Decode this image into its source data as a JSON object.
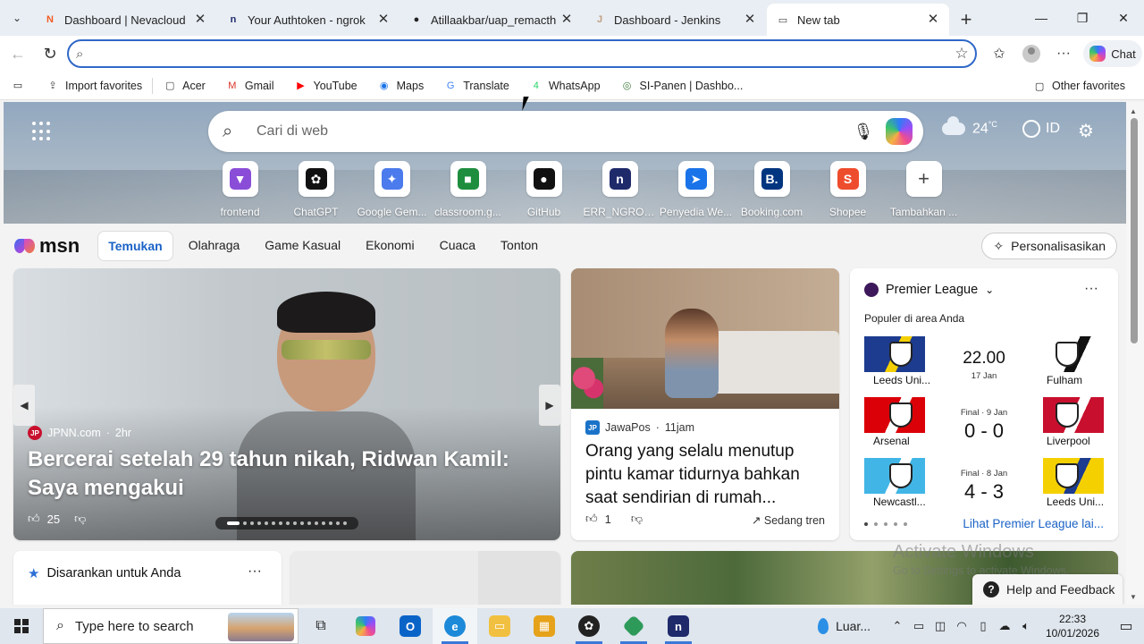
{
  "tabs": [
    {
      "title": "Dashboard | Nevacloud",
      "icon": "nevacloud-icon",
      "color": "#f25c22",
      "glyph": "N"
    },
    {
      "title": "Your Authtoken - ngrok",
      "icon": "ngrok-icon",
      "color": "#1f2a6b",
      "glyph": "n"
    },
    {
      "title": "Atillaakbar/uap_remacth",
      "icon": "github-icon",
      "color": "#222222",
      "glyph": "●"
    },
    {
      "title": "Dashboard - Jenkins",
      "icon": "jenkins-icon",
      "color": "#c0a080",
      "glyph": "J"
    },
    {
      "title": "New tab",
      "icon": "new-tab-icon",
      "color": "#444444",
      "glyph": "▭"
    }
  ],
  "toolbar": {
    "chat_label": "Chat",
    "address_placeholder": ""
  },
  "favorites": [
    {
      "label": "Import favorites",
      "icon": "import-icon",
      "glyph": "⇪",
      "color": "#444444"
    },
    {
      "label": "Acer",
      "icon": "folder-icon",
      "glyph": "▢",
      "color": "#444444"
    },
    {
      "label": "Gmail",
      "icon": "gmail-icon",
      "glyph": "M",
      "color": "#d93025"
    },
    {
      "label": "YouTube",
      "icon": "youtube-icon",
      "glyph": "▶",
      "color": "#ff0000"
    },
    {
      "label": "Maps",
      "icon": "maps-icon",
      "glyph": "◉",
      "color": "#1a73e8"
    },
    {
      "label": "Translate",
      "icon": "translate-icon",
      "glyph": "G",
      "color": "#4285f4"
    },
    {
      "label": "WhatsApp",
      "icon": "whatsapp-icon",
      "glyph": "4",
      "color": "#25d366"
    },
    {
      "label": "SI-Panen | Dashbo...",
      "icon": "si-panen-icon",
      "glyph": "◎",
      "color": "#3a7a3a"
    }
  ],
  "other_favorites": "Other favorites",
  "ntp": {
    "search_placeholder": "Cari di web",
    "temperature": "24",
    "temp_unit": "°C",
    "language": "ID",
    "quick_links": [
      {
        "label": "frontend",
        "glyph": "▼",
        "color": "#8a4dd8"
      },
      {
        "label": "ChatGPT",
        "glyph": "✿",
        "color": "#111111"
      },
      {
        "label": "Google Gem...",
        "glyph": "✦",
        "color": "#4b7bec"
      },
      {
        "label": "classroom.g...",
        "glyph": "■",
        "color": "#1e8e3e"
      },
      {
        "label": "GitHub",
        "glyph": "●",
        "color": "#111111"
      },
      {
        "label": "ERR_NGROK...",
        "glyph": "n",
        "color": "#1f2a6b"
      },
      {
        "label": "Penyedia We...",
        "glyph": "➤",
        "color": "#1a73e8"
      },
      {
        "label": "Booking.com",
        "glyph": "B.",
        "color": "#003580"
      },
      {
        "label": "Shopee",
        "glyph": "S",
        "color": "#ee4d2d"
      },
      {
        "label": "Tambahkan ...",
        "glyph": "+",
        "color": "#444444"
      }
    ],
    "msn_label": "msn",
    "feed_tabs": [
      "Temukan",
      "Olahraga",
      "Game Kasual",
      "Ekonomi",
      "Cuaca",
      "Tonton"
    ],
    "personalize_label": "Personalisasikan"
  },
  "hero": {
    "source": "JPNN.com",
    "age": "2hr",
    "title": "Bercerai setelah 29 tahun nikah, Ridwan Kamil: Saya mengakui",
    "likes": "25",
    "slide_index": 0,
    "slide_count": 16
  },
  "news": {
    "source": "JawaPos",
    "age": "11jam",
    "title": "Orang yang selalu menutup pintu kamar tidurnya bahkan saat sendirian di rumah...",
    "likes": "1",
    "trend": "Sedang tren"
  },
  "premier_league": {
    "title": "Premier League",
    "subtitle": "Populer di area Anda",
    "matches": [
      {
        "home": "Leeds Uni...",
        "away": "Fulham",
        "status": "",
        "score": "",
        "time": "22.00",
        "date": "17 Jan",
        "home_colors": [
          "#1d3c8f",
          "#f5d000"
        ],
        "away_colors": [
          "#ffffff",
          "#111111"
        ]
      },
      {
        "home": "Arsenal",
        "away": "Liverpool",
        "status": "Final · 9 Jan",
        "score": "0 - 0",
        "time": "",
        "date": "",
        "home_colors": [
          "#db0007",
          "#ffffff"
        ],
        "away_colors": [
          "#c8102e",
          "#ffffff"
        ]
      },
      {
        "home": "Newcastl...",
        "away": "Leeds Uni...",
        "status": "Final · 8 Jan",
        "score": "4 - 3",
        "time": "",
        "date": "",
        "home_colors": [
          "#41b6e6",
          "#ffffff"
        ],
        "away_colors": [
          "#f5d000",
          "#1d3c8f"
        ]
      }
    ],
    "page_index": 0,
    "page_count": 5,
    "more_link": "Lihat Premier League lai..."
  },
  "suggested": {
    "title": "Disarankan untuk Anda"
  },
  "watermark": {
    "line1": "Activate Windows",
    "line2": "Go to Settings to activate Windows."
  },
  "help_label": "Help and Feedback",
  "taskbar": {
    "search_placeholder": "Type here to search",
    "weather_text": "Luar...",
    "time": "22:33",
    "date": "10/01/2026"
  }
}
